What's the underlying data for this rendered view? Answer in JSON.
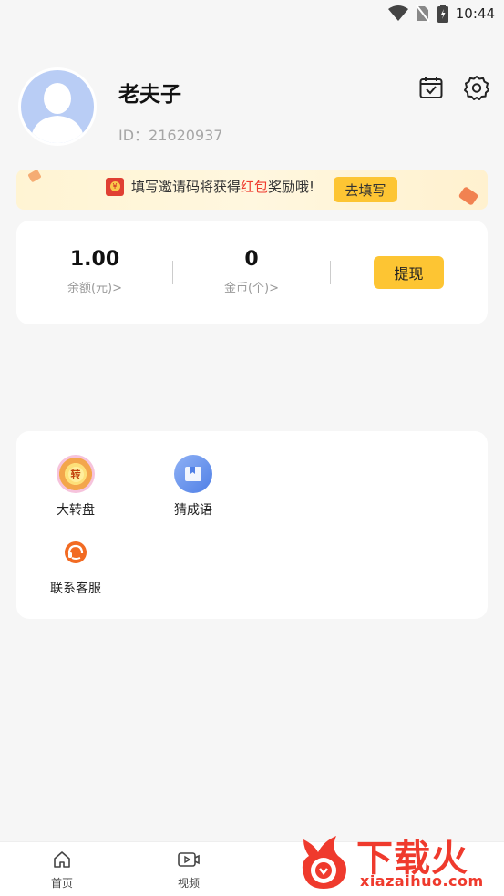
{
  "status_bar": {
    "time": "10:44"
  },
  "profile": {
    "name": "老夫子",
    "id_text": "ID：21620937"
  },
  "invite_banner": {
    "text_before": "填写邀请码将获得",
    "text_highlight": "红包",
    "text_after": "奖励哦!",
    "button_label": "去填写",
    "redpack_symbol": "¥"
  },
  "wallet": {
    "balance_value": "1.00",
    "balance_label": "余额(元)>",
    "coins_value": "0",
    "coins_label": "金币(个)>",
    "withdraw_label": "提现"
  },
  "services": [
    {
      "label": "大转盘",
      "icon": "wheel-icon",
      "glyph": "转"
    },
    {
      "label": "猜成语",
      "icon": "book-icon",
      "glyph": ""
    },
    {
      "label": "联系客服",
      "icon": "headset-icon",
      "glyph": ""
    }
  ],
  "bottom_nav": [
    {
      "label": "首页",
      "icon": "home-icon"
    },
    {
      "label": "视频",
      "icon": "video-icon"
    }
  ],
  "watermark": {
    "title": "下载火",
    "subtitle": "xiazaihuo.com"
  },
  "colors": {
    "accent_yellow": "#fdc533",
    "highlight_red": "#ef3a2d",
    "avatar_blue": "#b9cdf5"
  }
}
